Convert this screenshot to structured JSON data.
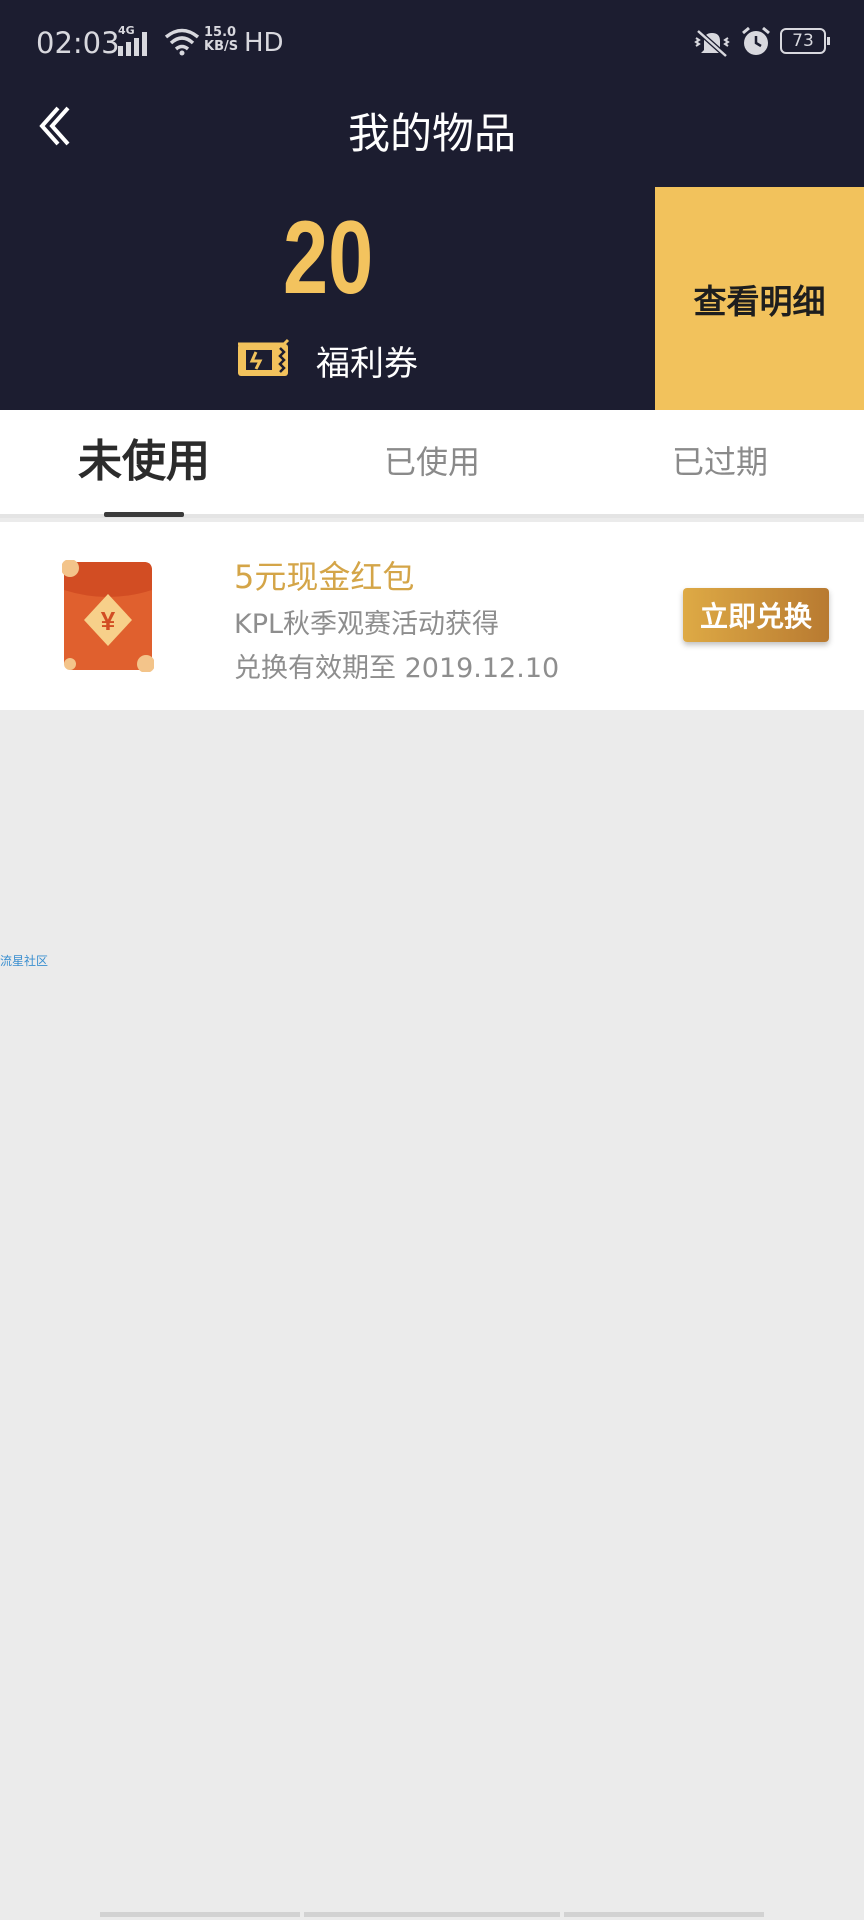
{
  "status_bar": {
    "time": "02:03",
    "network": "4G",
    "speed_value": "15.0",
    "speed_unit": "KB/S",
    "hd": "HD",
    "battery": "73"
  },
  "header": {
    "title": "我的物品",
    "back_icon": "chevron-left-icon"
  },
  "summary": {
    "count": "20",
    "ticket_label": "福利券",
    "ticket_icon": "ticket-icon",
    "detail_button": "查看明细"
  },
  "tabs": {
    "items": [
      {
        "label": "未使用",
        "active": true
      },
      {
        "label": "已使用",
        "active": false
      },
      {
        "label": "已过期",
        "active": false
      }
    ]
  },
  "vouchers": [
    {
      "title": "5元现金红包",
      "source": "KPL秋季观赛活动获得",
      "expiry": "兑换有效期至 2019.12.10",
      "button": "立即兑换",
      "icon": "red-envelope-icon"
    }
  ],
  "watermark": "流星社区",
  "colors": {
    "header_bg": "#1c1d30",
    "accent": "#f2c25c",
    "voucher_title": "#d4a548",
    "page_bg": "#ebebeb"
  }
}
